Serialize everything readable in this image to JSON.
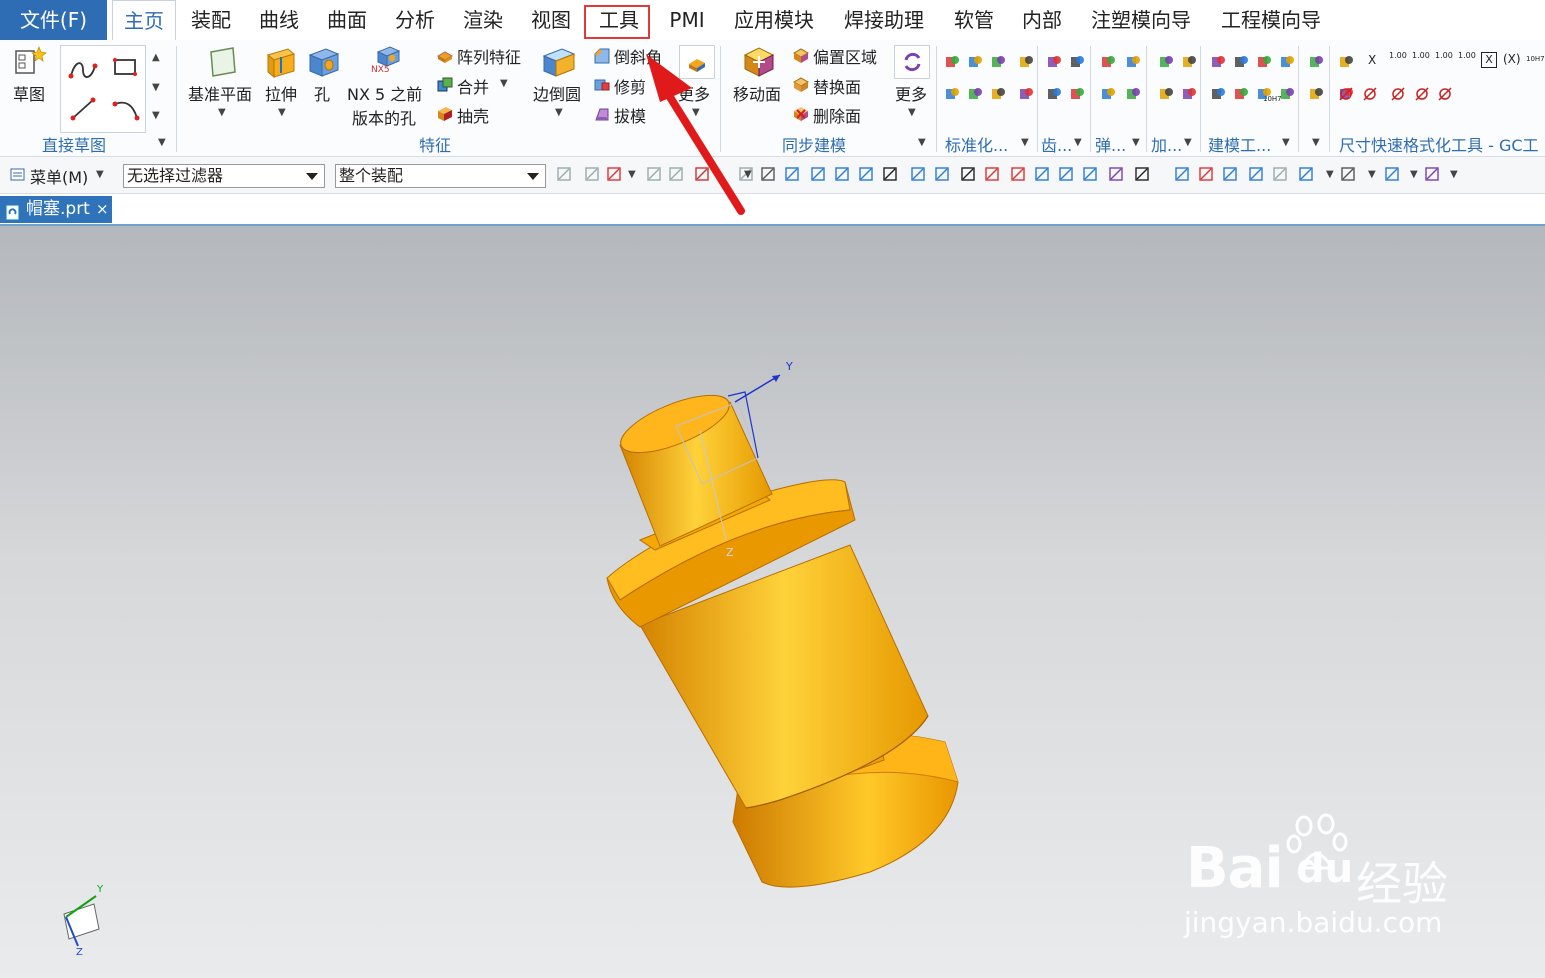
{
  "menu": {
    "file": "文件(F)",
    "tabs": [
      "主页",
      "装配",
      "曲线",
      "曲面",
      "分析",
      "渲染",
      "视图",
      "工具",
      "PMI",
      "应用模块",
      "焊接助理",
      "软管",
      "内部",
      "注塑模向导",
      "工程模向导"
    ]
  },
  "ribbon": {
    "sketch": "草图",
    "direct_sketch_group": "直接草图",
    "datum_plane": "基准平面",
    "extrude": "拉伸",
    "hole": "孔",
    "nx5_hole_line1": "NX 5 之前",
    "nx5_hole_line2": "版本的孔",
    "nx5_badge": "NX5",
    "pattern_feature": "阵列特征",
    "unite": "合并",
    "shell": "抽壳",
    "edge_blend": "边倒圆",
    "chamfer": "倒斜角",
    "trim": "修剪",
    "draft": "拔模",
    "more1": "更多",
    "feature_group": "特征",
    "move_face": "移动面",
    "offset_region": "偏置区域",
    "replace_face": "替换面",
    "delete_face": "删除面",
    "more2": "更多",
    "sync_group": "同步建模",
    "standardize_group": "标准化...",
    "gear_group": "齿...",
    "spring_group": "弹...",
    "add_group": "加...",
    "modeling_tools_group": "建模工...",
    "dim_format_group": "尺寸快速格式化工具 - GC工",
    "dim_labels": [
      "1.00",
      "1.00",
      "1.00",
      "1.00",
      "10H7"
    ],
    "x_label": "X",
    "boxx_label": "X",
    "parx_label": "(X)",
    "h7_label": "10H7"
  },
  "toolbar": {
    "menu": "菜单(M)",
    "filter": "无选择过滤器",
    "scope": "整个装配"
  },
  "document": {
    "tab_label": "帽塞.prt",
    "close": "×"
  },
  "viewport": {
    "axis_y": "Y",
    "axis_z": "Z"
  },
  "watermark": {
    "brand": "Bai",
    "brand2": "du",
    "jingyan": "经验",
    "url": "jingyan.baidu.com"
  },
  "colors": {
    "accent": "#2e6db3",
    "part": "#f5a500",
    "highlight": "#e23a3a"
  }
}
